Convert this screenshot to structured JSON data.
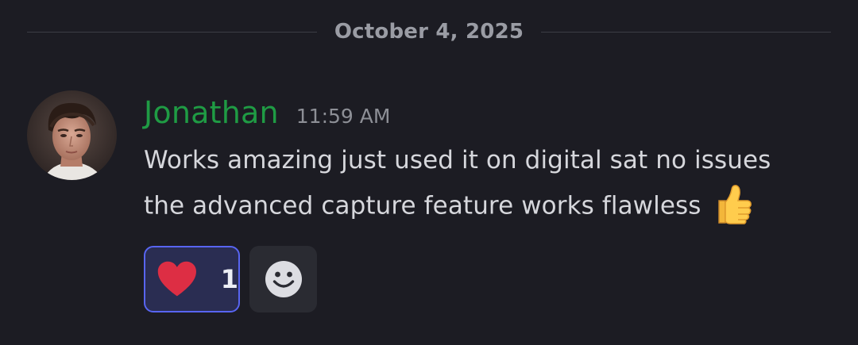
{
  "divider": {
    "date": "October 4, 2025"
  },
  "message": {
    "author": "Jonathan",
    "author_color": "#1f9b44",
    "timestamp": "11:59 AM",
    "text_line1": "Works amazing just used it on digital sat no issues",
    "text_line2": "the advanced capture feature works flawless",
    "inline_emoji": "thumbs-up-icon",
    "avatar": "avatar"
  },
  "reactions": [
    {
      "emoji": "heart-icon",
      "count": "1",
      "active": true
    }
  ],
  "add_reaction": {
    "icon": "smiley-icon"
  },
  "colors": {
    "background": "#1c1c23",
    "accent": "#5865f2"
  }
}
